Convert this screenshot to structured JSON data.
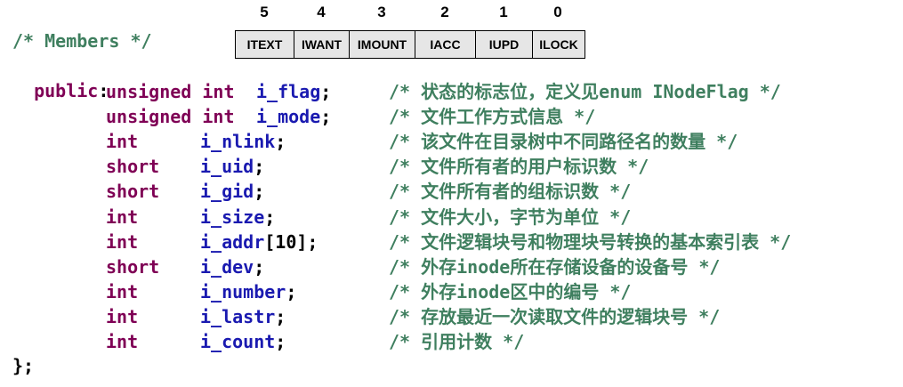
{
  "bit_numbers": [
    "5",
    "4",
    "3",
    "2",
    "1",
    "0"
  ],
  "flags": [
    "ITEXT",
    "IWANT",
    "IMOUNT",
    "IACC",
    "IUPD",
    "ILOCK"
  ],
  "header_comment": "/* Members */",
  "access_keyword": "public",
  "access_colon": ":",
  "members": [
    {
      "type": "unsigned int",
      "name": "i_flag",
      "suffix": ";",
      "comment": "/* 状态的标志位，定义见enum INodeFlag */"
    },
    {
      "type": "unsigned int",
      "name": "i_mode",
      "suffix": ";",
      "comment": "/* 文件工作方式信息 */"
    },
    {
      "type": "int",
      "name": "i_nlink",
      "suffix": ";",
      "comment": "/* 该文件在目录树中不同路径名的数量 */"
    },
    {
      "type": "short",
      "name": "i_uid",
      "suffix": ";",
      "comment": "/* 文件所有者的用户标识数 */"
    },
    {
      "type": "short",
      "name": "i_gid",
      "suffix": ";",
      "comment": "/* 文件所有者的组标识数 */"
    },
    {
      "type": "int",
      "name": "i_size",
      "suffix": ";",
      "comment": "/* 文件大小，字节为单位 */"
    },
    {
      "type": "int",
      "name": "i_addr",
      "suffix": "[10];",
      "comment": "/* 文件逻辑块号和物理块号转换的基本索引表 */"
    },
    {
      "type": "short",
      "name": "i_dev",
      "suffix": ";",
      "comment": "/* 外存inode所在存储设备的设备号 */"
    },
    {
      "type": "int",
      "name": "i_number",
      "suffix": ";",
      "comment": "/* 外存inode区中的编号 */"
    },
    {
      "type": "int",
      "name": "i_lastr",
      "suffix": ";",
      "comment": "/* 存放最近一次读取文件的逻辑块号 */"
    },
    {
      "type": "int",
      "name": "i_count",
      "suffix": ";",
      "comment": "/* 引用计数 */"
    }
  ],
  "closing": "};"
}
